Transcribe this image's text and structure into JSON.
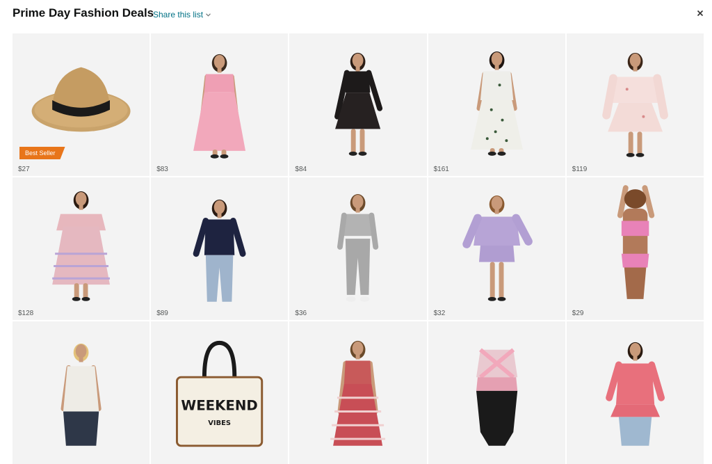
{
  "header": {
    "title": "Prime Day Fashion Deals",
    "share_label": "Share this list",
    "close_icon": "close-icon"
  },
  "colors": {
    "link": "#007185",
    "badge": "#e8751a",
    "tile_bg": "#f3f3f3"
  },
  "products": [
    {
      "price": "$27",
      "badge": "Best Seller",
      "art": "straw-hat"
    },
    {
      "price": "$83",
      "badge": "",
      "art": "pink-dress"
    },
    {
      "price": "$84",
      "badge": "",
      "art": "black-lace-dress"
    },
    {
      "price": "$161",
      "badge": "",
      "art": "white-floral-maxi"
    },
    {
      "price": "$119",
      "badge": "",
      "art": "off-shoulder-dress"
    },
    {
      "price": "$128",
      "badge": "",
      "art": "pastel-tunic"
    },
    {
      "price": "$89",
      "badge": "",
      "art": "navy-lace-top"
    },
    {
      "price": "$36",
      "badge": "",
      "art": "grey-lounge-set"
    },
    {
      "price": "$32",
      "badge": "",
      "art": "lavender-set"
    },
    {
      "price": "$29",
      "badge": "",
      "art": "pink-bikini"
    },
    {
      "price": "",
      "badge": "",
      "art": "white-cami"
    },
    {
      "price": "",
      "badge": "",
      "art": "weekend-tote",
      "art_text_1": "WEEKEND",
      "art_text_2": "VIBES"
    },
    {
      "price": "",
      "badge": "",
      "art": "gingham-dress"
    },
    {
      "price": "",
      "badge": "",
      "art": "swimsuit"
    },
    {
      "price": "",
      "badge": "",
      "art": "pink-peplum-top"
    }
  ]
}
